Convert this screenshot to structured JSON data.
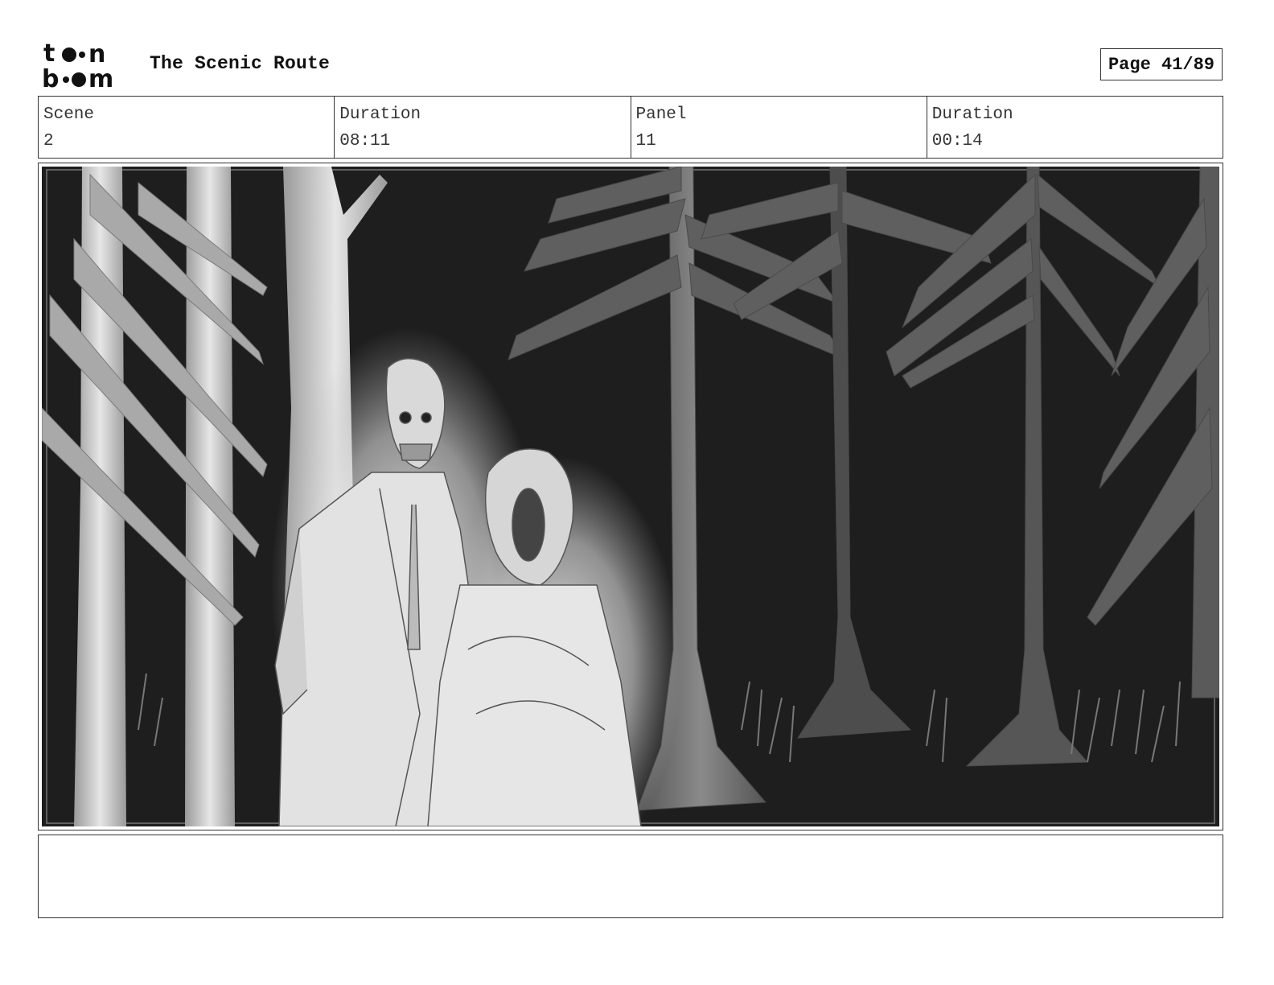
{
  "header": {
    "logo_text": "toon boom",
    "title": "The Scenic Route",
    "page_label": "Page 41/89"
  },
  "info": {
    "scene_label": "Scene",
    "scene_value": "2",
    "scene_duration_label": "Duration",
    "scene_duration_value": "08:11",
    "panel_label": "Panel",
    "panel_value": "11",
    "panel_duration_label": "Duration",
    "panel_duration_value": "00:14"
  },
  "panel": {
    "background_color": "#1e1e1e",
    "foreground_color": "#d8d8d8"
  },
  "notes": {
    "text": ""
  }
}
